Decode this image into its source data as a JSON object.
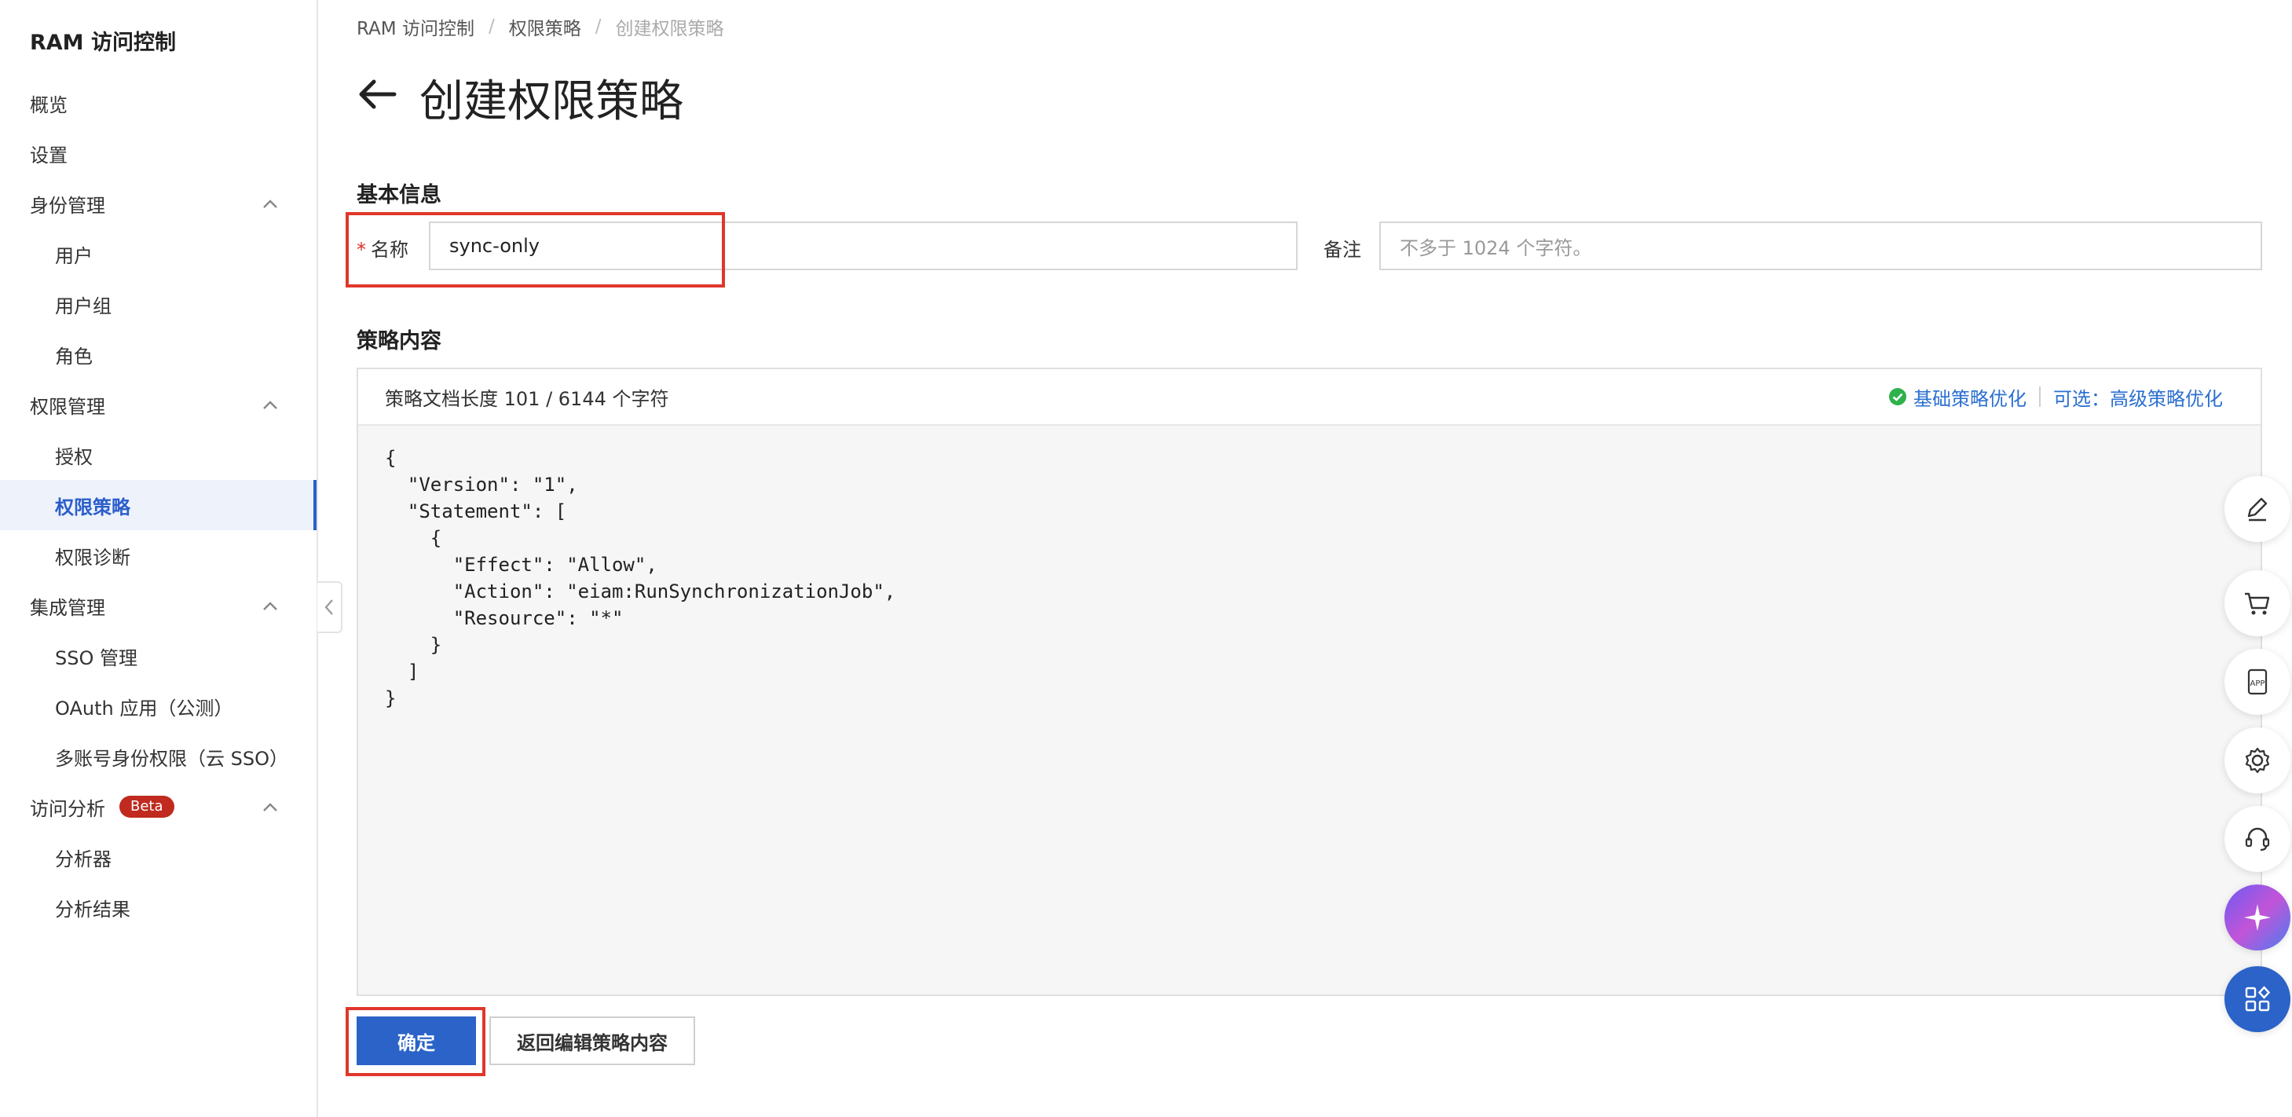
{
  "sidebar": {
    "title": "RAM 访问控制",
    "items": [
      {
        "label": "概览"
      },
      {
        "label": "设置"
      },
      {
        "label": "身份管理"
      },
      {
        "label": "用户"
      },
      {
        "label": "用户组"
      },
      {
        "label": "角色"
      },
      {
        "label": "权限管理"
      },
      {
        "label": "授权"
      },
      {
        "label": "权限策略"
      },
      {
        "label": "权限诊断"
      },
      {
        "label": "集成管理"
      },
      {
        "label": "SSO 管理"
      },
      {
        "label": "OAuth 应用（公测）"
      },
      {
        "label": "多账号身份权限（云 SSO）"
      },
      {
        "label": "访问分析",
        "badge": "Beta"
      },
      {
        "label": "分析器"
      },
      {
        "label": "分析结果"
      }
    ]
  },
  "breadcrumb": {
    "items": [
      "RAM 访问控制",
      "权限策略",
      "创建权限策略"
    ],
    "separator": "/"
  },
  "page": {
    "title": "创建权限策略"
  },
  "basic_info": {
    "title": "基本信息",
    "name_label": "名称",
    "required_mark": "*",
    "name_value": "sync-only",
    "note_label": "备注",
    "note_placeholder": "不多于 1024 个字符。"
  },
  "policy": {
    "title": "策略内容",
    "length_text": "策略文档长度 101 / 6144 个字符",
    "basic_optimize": "基础策略优化",
    "advanced_optimize": "可选：高级策略优化",
    "document": "{\n  \"Version\": \"1\",\n  \"Statement\": [\n    {\n      \"Effect\": \"Allow\",\n      \"Action\": \"eiam:RunSynchronizationJob\",\n      \"Resource\": \"*\"\n    }\n  ]\n}"
  },
  "buttons": {
    "confirm": "确定",
    "back_edit": "返回编辑策略内容"
  },
  "colors": {
    "primary": "#2b63c8",
    "highlight": "#e0372b",
    "success": "#2fb24c",
    "link": "#2b6fd1"
  }
}
